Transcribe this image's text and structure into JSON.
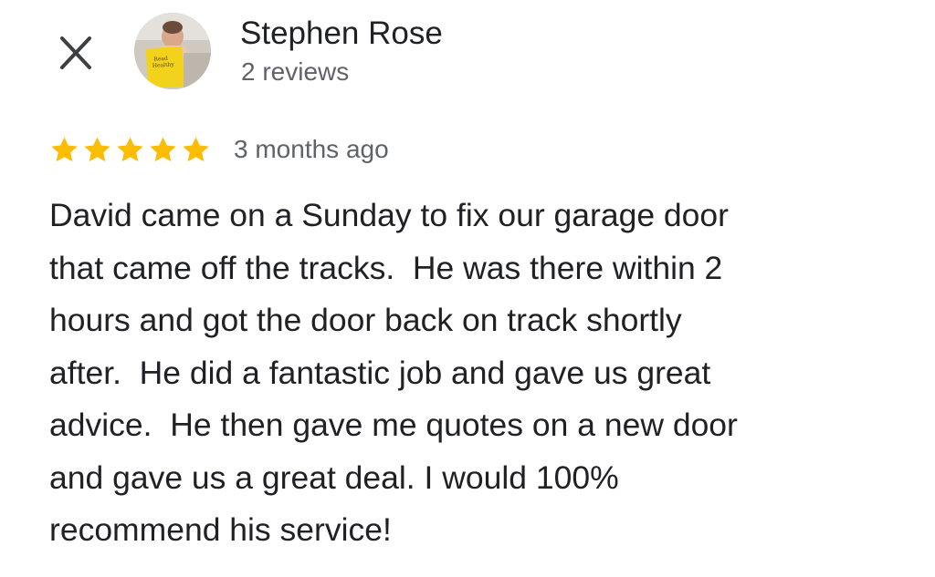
{
  "header": {
    "close_icon": "close-icon",
    "author_name": "Stephen Rose",
    "review_count": "2 reviews",
    "avatar_book_text": "Read Healthy"
  },
  "review": {
    "rating": 5,
    "rating_max": 5,
    "star_color": "#FBBC04",
    "time_ago": "3 months ago",
    "text_lines": [
      "David came on a Sunday to fix our garage door",
      "that came off the tracks.  He was there within 2",
      "hours and got the door back on track shortly",
      "after.  He did a fantastic job and gave us great",
      "advice.  He then gave me quotes on a new door",
      "and gave us a great deal. I would 100%",
      "recommend his service!"
    ]
  }
}
